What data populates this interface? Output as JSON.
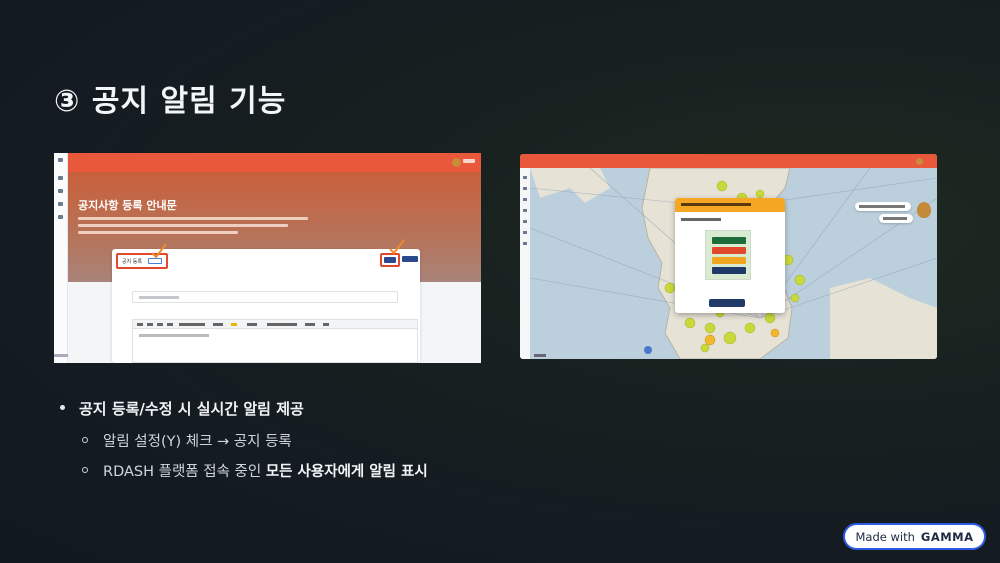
{
  "slide": {
    "title": "③ 공지 알림 기능"
  },
  "screenshot_left": {
    "banner_title": "공지사항 등록 안내문",
    "tab_label": "공지 등록"
  },
  "bullets": {
    "main": "공지 등록/수정 시 실시간 알림 제공",
    "sub1": "알림 설정(Y) 체크 → 공지 등록",
    "sub2_prefix": "RDASH 플랫폼 접속 중인 ",
    "sub2_bold": "모든 사용자에게 알림 표시"
  },
  "badge": {
    "prefix": "Made with",
    "brand": "GAMMA"
  },
  "colors": {
    "header_orange": "#e9583a",
    "modal_header": "#f5a623",
    "badge_border": "#2d5be3"
  }
}
